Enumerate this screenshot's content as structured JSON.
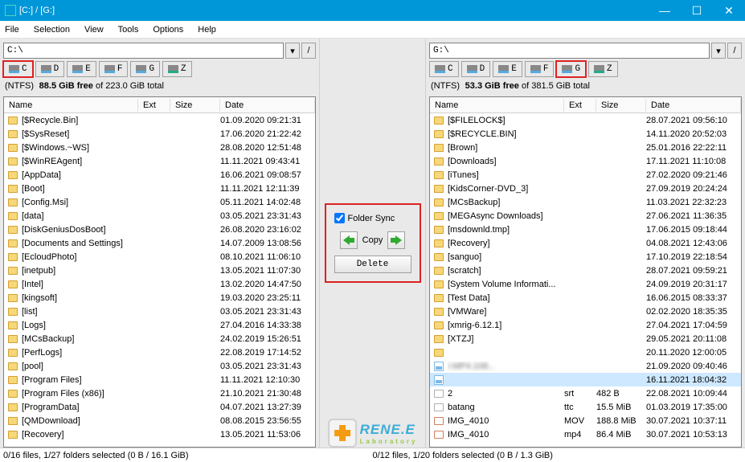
{
  "title": "[C:] / [G:]",
  "menu": [
    "File",
    "Selection",
    "View",
    "Tools",
    "Options",
    "Help"
  ],
  "winbtns": {
    "min": "—",
    "max": "☐",
    "close": "✕"
  },
  "left": {
    "path": "C:\\",
    "drives": [
      {
        "l": "C",
        "hl": true
      },
      {
        "l": "D"
      },
      {
        "l": "E"
      },
      {
        "l": "F"
      },
      {
        "l": "G"
      },
      {
        "l": "Z",
        "net": true
      }
    ],
    "fs": {
      "type": "(NTFS)",
      "free": "88.5 GiB free",
      "mid": " of ",
      "total": "223.0 GiB total"
    },
    "cols": {
      "name": "Name",
      "ext": "Ext",
      "size": "Size",
      "date": "Date"
    },
    "rows": [
      {
        "n": "[$Recycle.Bin]",
        "d": "01.09.2020 09:21:31"
      },
      {
        "n": "[$SysReset]",
        "d": "17.06.2020 21:22:42"
      },
      {
        "n": "[$Windows.~WS]",
        "d": "28.08.2020 12:51:48"
      },
      {
        "n": "[$WinREAgent]",
        "d": "11.11.2021 09:43:41"
      },
      {
        "n": "[AppData]",
        "d": "16.06.2021 09:08:57"
      },
      {
        "n": "[Boot]",
        "d": "11.11.2021 12:11:39"
      },
      {
        "n": "[Config.Msi]",
        "d": "05.11.2021 14:02:48"
      },
      {
        "n": "[data]",
        "d": "03.05.2021 23:31:43"
      },
      {
        "n": "[DiskGeniusDosBoot]",
        "d": "26.08.2020 23:16:02"
      },
      {
        "n": "[Documents and Settings]",
        "d": "14.07.2009 13:08:56"
      },
      {
        "n": "[EcloudPhoto]",
        "d": "08.10.2021 11:06:10"
      },
      {
        "n": "[inetpub]",
        "d": "13.05.2021 11:07:30"
      },
      {
        "n": "[Intel]",
        "d": "13.02.2020 14:47:50"
      },
      {
        "n": "[kingsoft]",
        "d": "19.03.2020 23:25:11"
      },
      {
        "n": "[list]",
        "d": "03.05.2021 23:31:43"
      },
      {
        "n": "[Logs]",
        "d": "27.04.2016 14:33:38"
      },
      {
        "n": "[MCsBackup]",
        "d": "24.02.2019 15:26:51"
      },
      {
        "n": "[PerfLogs]",
        "d": "22.08.2019 17:14:52"
      },
      {
        "n": "[pool]",
        "d": "03.05.2021 23:31:43"
      },
      {
        "n": "[Program Files]",
        "d": "11.11.2021 12:10:30"
      },
      {
        "n": "[Program Files (x86)]",
        "d": "21.10.2021 21:30:48"
      },
      {
        "n": "[ProgramData]",
        "d": "04.07.2021 13:27:39"
      },
      {
        "n": "[QMDownload]",
        "d": "08.08.2015 23:56:55"
      },
      {
        "n": "[Recovery]",
        "d": "13.05.2021 11:53:06"
      }
    ],
    "status": "0/16 files, 1/27 folders selected (0 B / 16.1 GiB)"
  },
  "right": {
    "path": "G:\\",
    "drives": [
      {
        "l": "C"
      },
      {
        "l": "D"
      },
      {
        "l": "E"
      },
      {
        "l": "F"
      },
      {
        "l": "G",
        "hl": true
      },
      {
        "l": "Z",
        "net": true
      }
    ],
    "fs": {
      "type": "(NTFS)",
      "free": "53.3 GiB free",
      "mid": " of ",
      "total": "381.5 GiB total"
    },
    "cols": {
      "name": "Name",
      "ext": "Ext",
      "size": "Size",
      "date": "Date"
    },
    "rows": [
      {
        "n": "[$FILELOCK$]",
        "d": "28.07.2021 09:56:10"
      },
      {
        "n": "[$RECYCLE.BIN]",
        "d": "14.11.2020 20:52:03"
      },
      {
        "n": "[Brown]",
        "d": "25.01.2016 22:22:11"
      },
      {
        "n": "[Downloads]",
        "d": "17.11.2021 11:10:08"
      },
      {
        "n": "[iTunes]",
        "d": "27.02.2020 09:21:46"
      },
      {
        "n": "[KidsCorner-DVD_3]",
        "d": "27.09.2019 20:24:24"
      },
      {
        "n": "[MCsBackup]",
        "d": "11.03.2021 22:32:23"
      },
      {
        "n": "[MEGAsync Downloads]",
        "d": "27.06.2021 11:36:35"
      },
      {
        "n": "[msdownld.tmp]",
        "d": "17.06.2015 09:18:44"
      },
      {
        "n": "[Recovery]",
        "d": "04.08.2021 12:43:06"
      },
      {
        "n": "[sanguo]",
        "d": "17.10.2019 22:18:54"
      },
      {
        "n": "[scratch]",
        "d": "28.07.2021 09:59:21"
      },
      {
        "n": "[System Volume Informati...",
        "d": "24.09.2019 20:31:17"
      },
      {
        "n": "[Test Data]",
        "d": "16.06.2015 08:33:37"
      },
      {
        "n": "[VMWare]",
        "d": "02.02.2020 18:35:35"
      },
      {
        "n": "[xmrig-6.12.1]",
        "d": "27.04.2021 17:04:59"
      },
      {
        "n": "[XTZJ]",
        "d": "29.05.2021 20:11:08"
      },
      {
        "n": "",
        "d": "20.11.2020 12:00:05",
        "blur": true
      },
      {
        "n": "I.MP4.108...",
        "d": "21.09.2020 09:40:46",
        "blur": true,
        "ico": "pic"
      },
      {
        "n": "",
        "d": "16.11.2021 18:04:32",
        "sel": true,
        "blur": true,
        "ico": "pic"
      },
      {
        "n": "2",
        "e": "srt",
        "s": "482 B",
        "d": "22.08.2021 10:09:44",
        "ico": "file"
      },
      {
        "n": "batang",
        "e": "ttc",
        "s": "15.5 MiB",
        "d": "01.03.2019 17:35:00",
        "ico": "file"
      },
      {
        "n": "IMG_4010",
        "e": "MOV",
        "s": "188.8 MiB",
        "d": "30.07.2021 10:37:11",
        "ico": "vid"
      },
      {
        "n": "IMG_4010",
        "e": "mp4",
        "s": "86.4 MiB",
        "d": "30.07.2021 10:53:13",
        "ico": "vid"
      }
    ],
    "status": "0/12 files, 1/20 folders selected (0 B / 1.3 GiB)"
  },
  "sync": {
    "label": "Folder Sync",
    "copy": "Copy",
    "del": "Delete"
  },
  "logo": {
    "big": "RENE.E",
    "sub": "Laboratory"
  }
}
